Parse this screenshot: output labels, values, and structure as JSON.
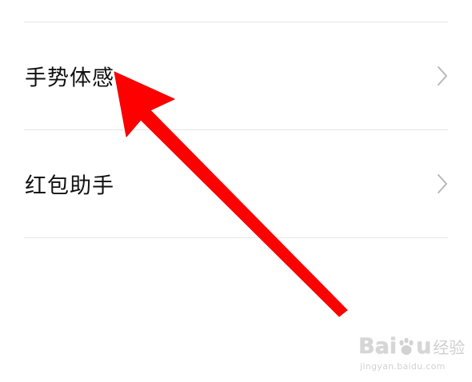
{
  "settings_list": {
    "items": [
      {
        "label": "手势体感",
        "chevron": "chevron-right-icon"
      },
      {
        "label": "红包助手",
        "chevron": "chevron-right-icon"
      }
    ]
  },
  "annotation": {
    "type": "arrow",
    "color": "#ff0000",
    "points_to": "手势体感"
  },
  "watermark": {
    "brand_latin_1": "Bai",
    "brand_latin_2": "u",
    "brand_cn": "经验",
    "url": "jingyan.baidu.com"
  },
  "colors": {
    "background": "#ffffff",
    "text": "#111111",
    "divider": "#e6e6e6",
    "chevron": "#b8b8b8"
  }
}
